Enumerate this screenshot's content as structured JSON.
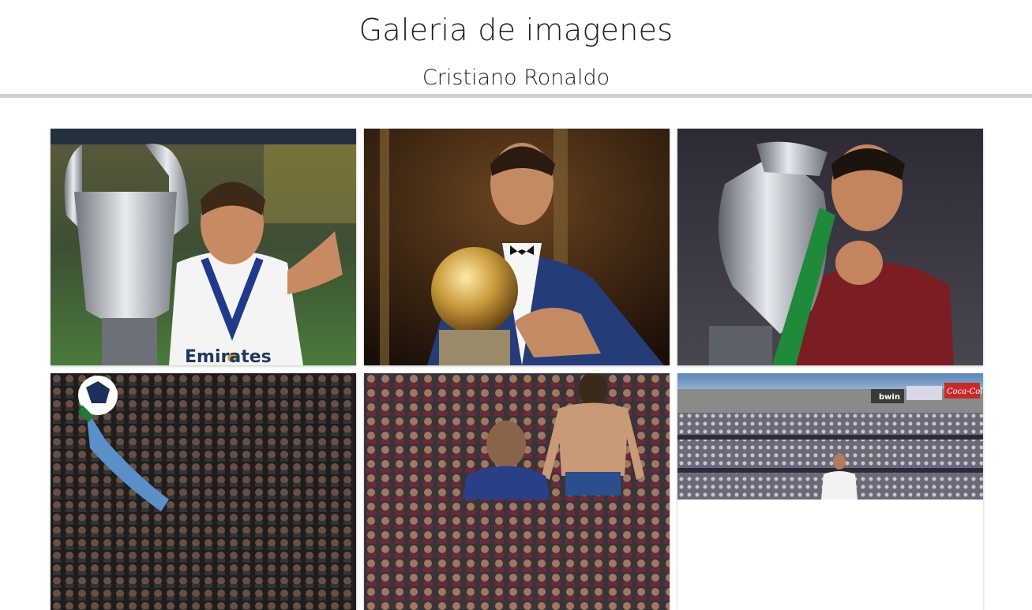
{
  "header": {
    "title": "Galeria de imagenes",
    "subtitle": "Cristiano Ronaldo"
  },
  "gallery": {
    "images": [
      {
        "name": "ronaldo-champions-trophy-photo",
        "text": "Emirates",
        "colors": {
          "bg": "#3a4a2e",
          "shirt": "#f4f4f4",
          "accent": "#c8ccd2"
        }
      },
      {
        "name": "ronaldo-ballon-dor-photo",
        "colors": {
          "bg": "#2a1a10",
          "shirt": "#243c78",
          "accent": "#c79a3a"
        }
      },
      {
        "name": "ronaldo-euro-trophy-photo",
        "colors": {
          "bg": "#33313c",
          "shirt": "#7a1e24",
          "accent": "#b8bcc4"
        }
      },
      {
        "name": "ronaldo-bicycle-kick-photo",
        "colors": {
          "bg": "#2e2a2a",
          "shirt": "#5a8fc8",
          "accent": "#ffffff"
        }
      },
      {
        "name": "ronaldo-shirtless-celebration-photo",
        "colors": {
          "bg": "#3a3438",
          "shirt": "#c99a78",
          "accent": "#2a4f8c"
        }
      },
      {
        "name": "ronaldo-stadium-photo",
        "signs": [
          "bwin",
          "Coca-Cola"
        ],
        "colors": {
          "bg": "#4a6a8a",
          "shirt": "#f2f2f2",
          "accent": "#c72a2a"
        }
      }
    ]
  }
}
